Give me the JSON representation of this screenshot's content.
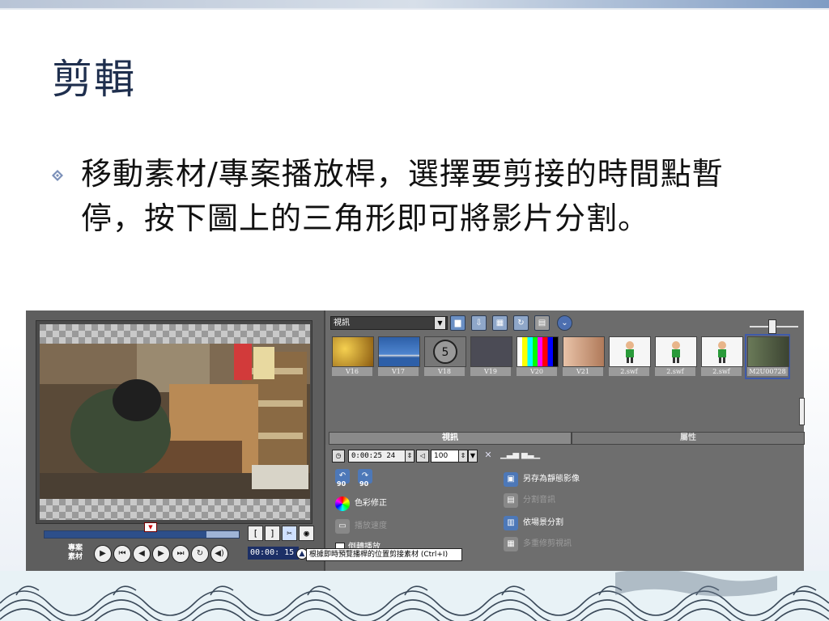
{
  "slide": {
    "title": "剪輯",
    "bullet": "移動素材/專案播放桿，選擇要剪接的時間點暫停，按下圖上的三角形即可將影片分割。"
  },
  "player": {
    "mode_label_line1": "專案",
    "mode_label_line2": "素材",
    "mark_in": "[",
    "mark_out": "]",
    "timecode": "00:00: 15",
    "tooltip": "根據即時預覽播桿的位置剪接素材 (Ctrl+I)"
  },
  "library": {
    "category": "視訊",
    "thumbnails": [
      {
        "label": "V16",
        "color": "#c9a22a"
      },
      {
        "label": "V17",
        "color": "#3b6fb6"
      },
      {
        "label": "V18",
        "color": "#777777"
      },
      {
        "label": "V19",
        "color": "#5a5a62"
      },
      {
        "label": "V20",
        "color": "#d04a8a"
      },
      {
        "label": "V21",
        "color": "#c79a7a"
      },
      {
        "label": "2.swf",
        "color": "#f4f4f4"
      },
      {
        "label": "2.swf",
        "color": "#f4f4f4"
      },
      {
        "label": "2.swf",
        "color": "#f4f4f4"
      },
      {
        "label": "M2U00728",
        "color": "#5d6a4e"
      }
    ]
  },
  "options": {
    "tab_video": "視訊",
    "tab_attributes": "屬性",
    "duration": "0:00:25 24",
    "volume": "100",
    "rotate_left": "90",
    "rotate_right": "90",
    "color_correction": "色彩修正",
    "playback_speed": "播放速度",
    "reverse_playback": "倒轉播放",
    "save_still": "另存為靜態影像",
    "split_audio": "分割音訊",
    "scene_split": "依場景分割",
    "multi_trim": "多重修剪視訊"
  },
  "colors": {
    "title": "#1f2f4e",
    "timecode_bg": "#1c2f66"
  }
}
